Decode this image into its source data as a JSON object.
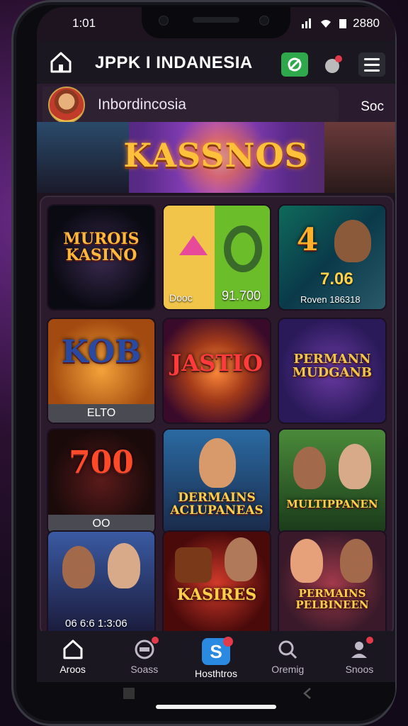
{
  "status": {
    "time": "1:01",
    "right_text": "2880"
  },
  "header": {
    "title": "JPPK I INDANESIA"
  },
  "user": {
    "name": "Inbordincosia",
    "right_label": "Soc"
  },
  "banner": {
    "title": "KASSNOS"
  },
  "tiles": [
    {
      "name": "MUROIS KASINO",
      "footer": ""
    },
    {
      "name": "",
      "left_caption": "Dooc",
      "value": "91.700"
    },
    {
      "name": "4",
      "big_value": "7.06",
      "caption": "Roven 186318"
    },
    {
      "name": "KOB",
      "footer": "ELTO"
    },
    {
      "name": "JASTIO",
      "footer": ""
    },
    {
      "name": "PERMANN MUDGANB",
      "footer": ""
    },
    {
      "name": "700",
      "footer": "OO"
    },
    {
      "name": "DERMAINS ACLUPANEAS",
      "footer": ""
    },
    {
      "name": "MULTIPPANEN",
      "footer": ""
    },
    {
      "name": "",
      "caption": "06 6:6 1:3:06"
    },
    {
      "name": "KASIRES",
      "footer": ""
    },
    {
      "name": "PERMAINS PELBINEEN",
      "footer": ""
    }
  ],
  "nav": [
    {
      "label": "Aroos",
      "icon": "home-icon"
    },
    {
      "label": "Soass",
      "icon": "chat-icon"
    },
    {
      "label": "Hosthtros",
      "icon": "s-logo-icon"
    },
    {
      "label": "Oremig",
      "icon": "search-icon"
    },
    {
      "label": "Snoos",
      "icon": "profile-icon"
    }
  ],
  "colors": {
    "accent_green": "#2fa84b",
    "badge_red": "#e23a4a",
    "gold": "#ffc13a"
  }
}
